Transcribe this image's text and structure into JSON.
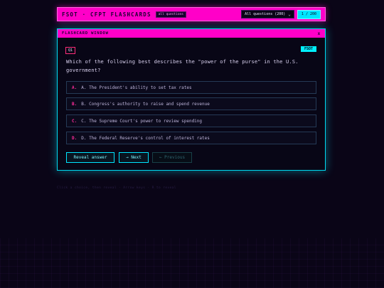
{
  "header": {
    "title": "FSOT · CFPT FLASHCARDS",
    "badge": "all questions",
    "filter_selected": "All questions (200)",
    "counter": "1 / 200"
  },
  "window": {
    "title": "FLASHCARD WINDOW",
    "close": "x"
  },
  "card": {
    "id": "Q1",
    "tag": "FSOT",
    "question": "Which of the following best describes the \"power of the purse\" in the U.S. government?",
    "options": [
      {
        "letter": "A.",
        "text": "A. The President's ability to set tax rates"
      },
      {
        "letter": "B.",
        "text": "B. Congress's authority to raise and spend revenue"
      },
      {
        "letter": "C.",
        "text": "C. The Supreme Court's power to review spending"
      },
      {
        "letter": "D.",
        "text": "D. The Federal Reserve's control of interest rates"
      }
    ]
  },
  "controls": {
    "reveal": "Reveal answer",
    "next": "→ Next",
    "previous": "← Previous"
  },
  "footer": "Click a choice, then reveal · Arrow keys · R to reveal",
  "colors": {
    "accent_pink": "#ff00c8",
    "accent_cyan": "#00e5ff",
    "background": "#0a0517"
  }
}
